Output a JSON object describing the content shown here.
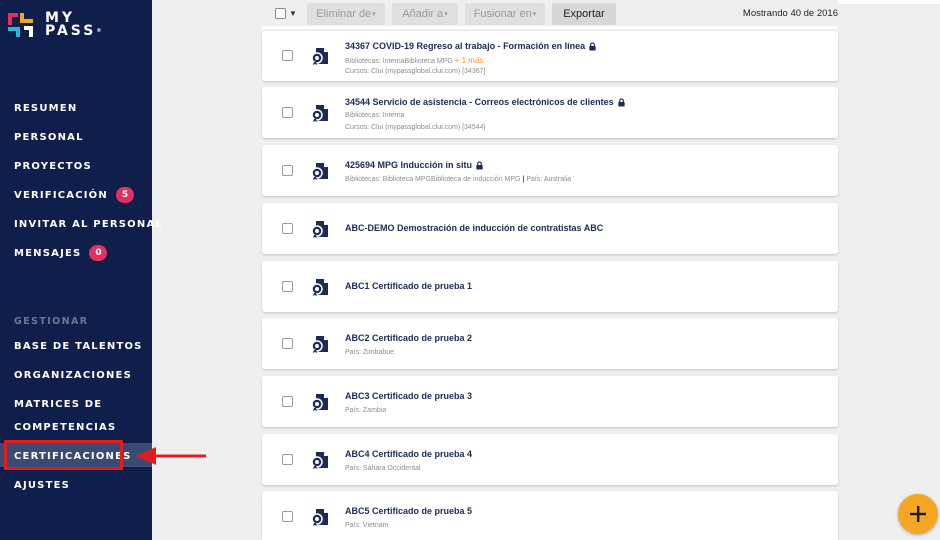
{
  "brand": {
    "line1": "MY",
    "line2": "PASS",
    "mark": "®"
  },
  "sidebar": {
    "items": [
      {
        "label": "RESUMEN"
      },
      {
        "label": "PERSONAL"
      },
      {
        "label": "PROYECTOS"
      },
      {
        "label": "VERIFICACIÓN",
        "badge": "5"
      },
      {
        "label": "INVITAR AL PERSONAL"
      },
      {
        "label": "MENSAJES",
        "badge": "0"
      }
    ],
    "section_label": "GESTIONAR",
    "manage_items": [
      {
        "label": "BASE DE TALENTOS"
      },
      {
        "label": "ORGANIZACIONES"
      },
      {
        "label_line1": "MATRICES DE",
        "label_line2": "COMPETENCIAS"
      },
      {
        "label": "CERTIFICACIONES",
        "active": true
      },
      {
        "label": "AJUSTES"
      }
    ]
  },
  "toolbar": {
    "delete_label": "Eliminar de",
    "add_label": "Añadir a",
    "merge_label": "Fusionar en",
    "export_label": "Exportar",
    "count_text": "Mostrando 40 de 2016"
  },
  "certifications": [
    {
      "title": "34367 COVID-19 Regreso al trabajo - Formación en línea",
      "locked": true,
      "meta1": "Bibliotecas: InternaBiblioteca MPG",
      "more": "+ 1 más",
      "meta2": "Cursos: Clui (mypassglobal.clui.com) [34367]"
    },
    {
      "title": "34544 Servicio de asistencia - Correos electrónicos de clientes",
      "locked": true,
      "meta1": "Bibliotecas: Interna",
      "meta2": "Cursos: Clui (mypassglobal.clui.com) [34544]"
    },
    {
      "title": "425694 MPG Inducción in situ",
      "locked": true,
      "meta1": "Bibliotecas: Biblioteca MPGBiblioteca de inducción MPG",
      "meta1b": "País: Australia"
    },
    {
      "title": "ABC-DEMO Demostración de inducción de contratistas ABC"
    },
    {
      "title": "ABC1 Certificado de prueba 1"
    },
    {
      "title": "ABC2 Certificado de prueba 2",
      "meta1": "País: Zimbabue"
    },
    {
      "title": "ABC3 Certificado de prueba 3",
      "meta1": "País: Zambia"
    },
    {
      "title": "ABC4 Certificado de prueba 4",
      "meta1": "País: Sáhara Occidental"
    },
    {
      "title": "ABC5 Certificado de prueba 5",
      "meta1": "País: Vietnam"
    }
  ],
  "colors": {
    "sidebar": "#0f1e4a",
    "accent": "#f5a623",
    "badge": "#e0315f",
    "highlight": "#e21c1c"
  }
}
